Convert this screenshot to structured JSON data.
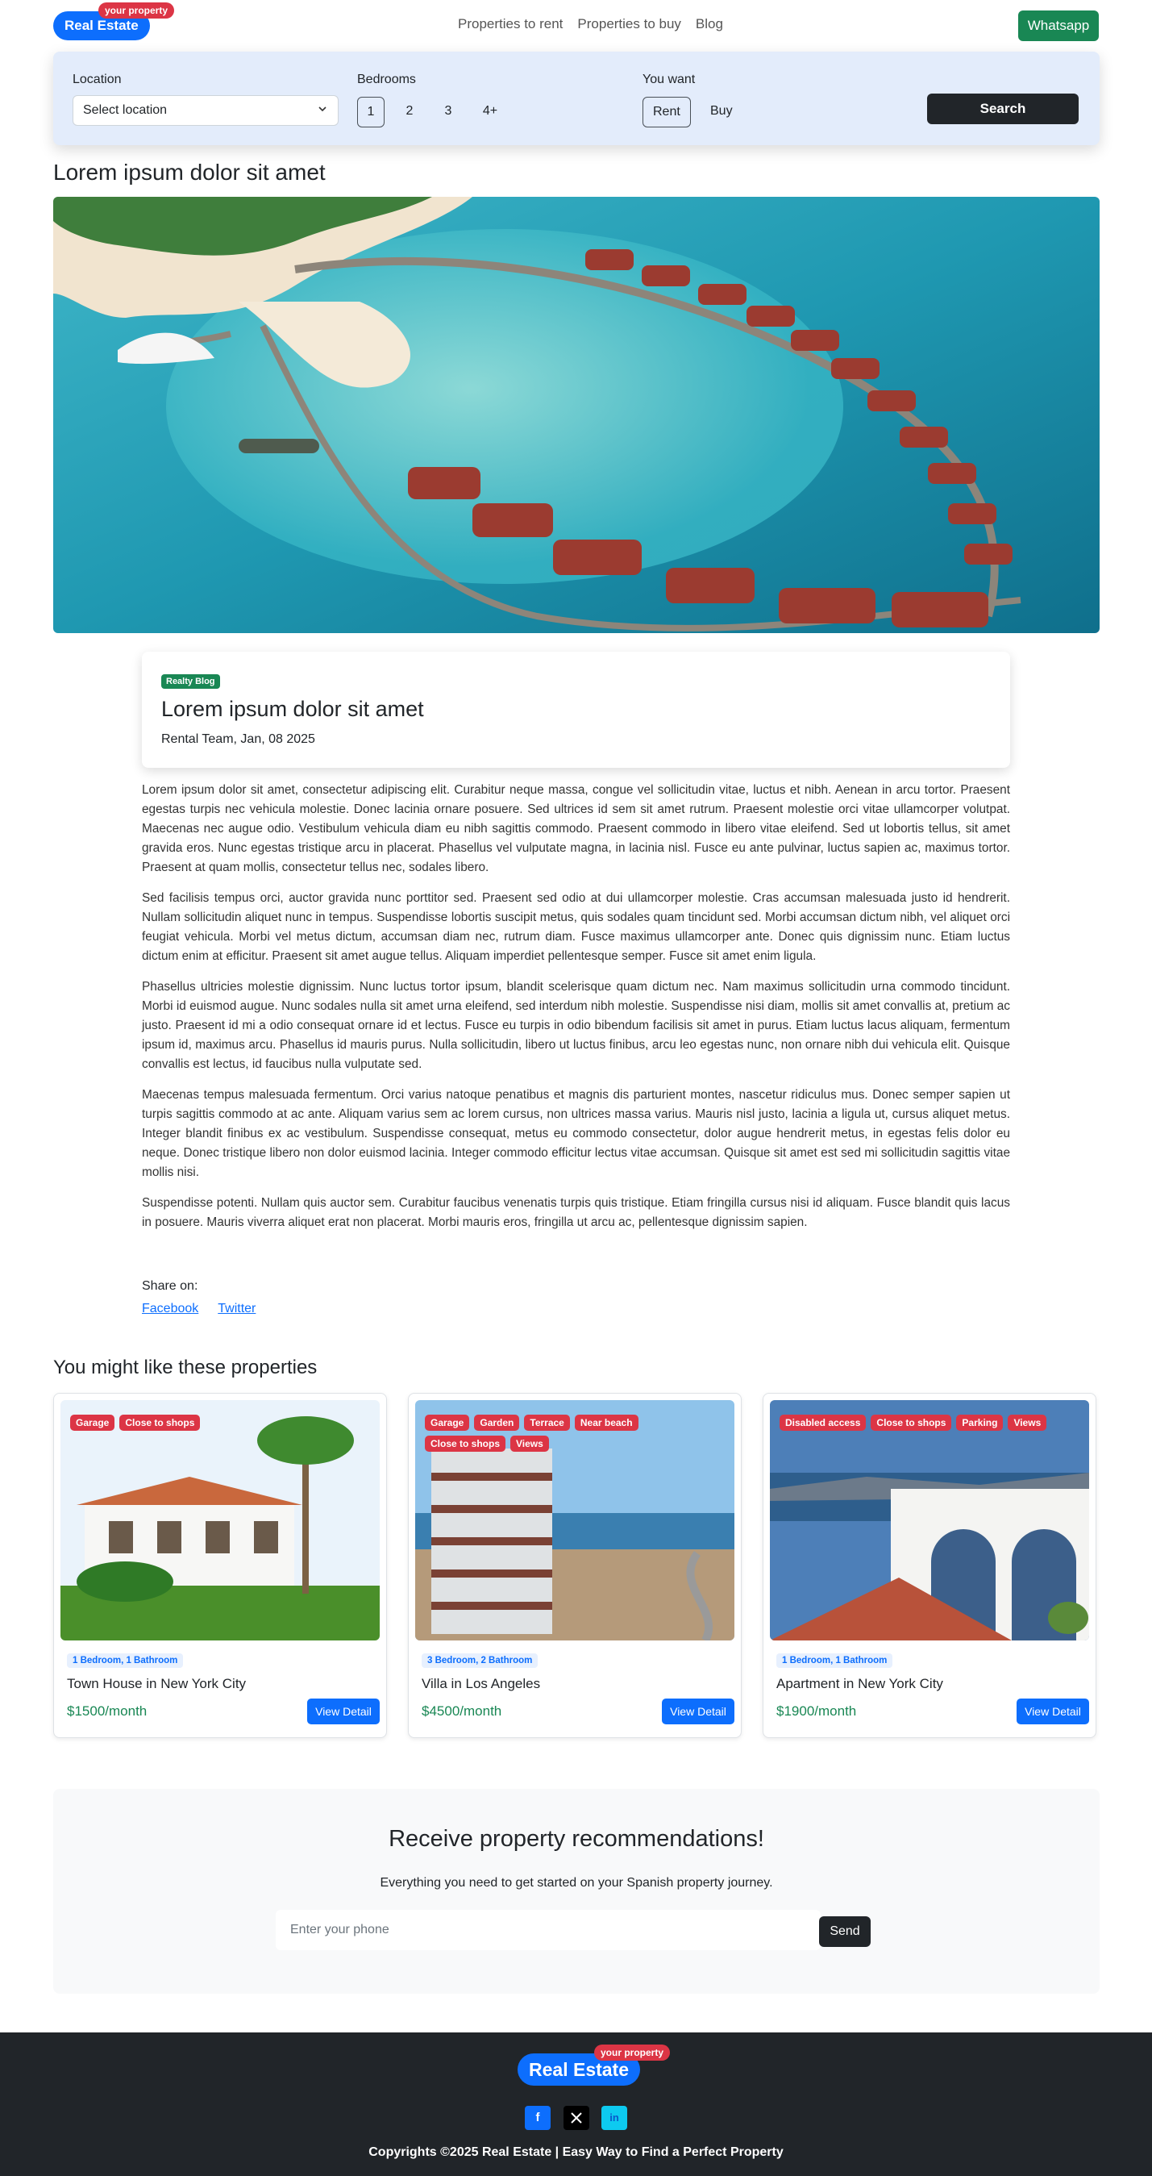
{
  "nav": {
    "logo": "Real Estate",
    "logo_badge": "your property",
    "links": [
      "Properties to rent",
      "Properties to buy",
      "Blog"
    ],
    "whatsapp": "Whatsapp"
  },
  "search": {
    "location_label": "Location",
    "location_value": "Select location",
    "bedrooms_label": "Bedrooms",
    "bedrooms": [
      "1",
      "2",
      "3",
      "4+"
    ],
    "bedrooms_selected": "1",
    "want_label": "You want",
    "want_options": [
      "Rent",
      "Buy"
    ],
    "want_selected": "Rent",
    "button": "Search"
  },
  "page_title": "Lorem ipsum dolor sit amet",
  "card": {
    "badge": "Realty Blog",
    "title": "Lorem ipsum dolor sit amet",
    "meta": "Rental Team,  Jan, 08 2025"
  },
  "article": [
    "Lorem ipsum dolor sit amet, consectetur adipiscing elit. Curabitur neque massa, congue vel sollicitudin vitae, luctus et nibh. Aenean in arcu tortor. Praesent egestas turpis nec vehicula molestie. Donec lacinia ornare posuere. Sed ultrices id sem sit amet rutrum. Praesent molestie orci vitae ullamcorper volutpat. Maecenas nec augue odio. Vestibulum vehicula diam eu nibh sagittis commodo. Praesent commodo in libero vitae eleifend. Sed ut lobortis tellus, sit amet gravida eros. Nunc egestas tristique arcu in placerat. Phasellus vel vulputate magna, in lacinia nisl. Fusce eu ante pulvinar, luctus sapien ac, maximus tortor. Praesent at quam mollis, consectetur tellus nec, sodales libero.",
    "Sed facilisis tempus orci, auctor gravida nunc porttitor sed. Praesent sed odio at dui ullamcorper molestie. Cras accumsan malesuada justo id hendrerit. Nullam sollicitudin aliquet nunc in tempus. Suspendisse lobortis suscipit metus, quis sodales quam tincidunt sed. Morbi accumsan dictum nibh, vel aliquet orci feugiat vehicula. Morbi vel metus dictum, accumsan diam nec, rutrum diam. Fusce maximus ullamcorper ante. Donec quis dignissim nunc. Etiam luctus dictum enim at efficitur. Praesent sit amet augue tellus. Aliquam imperdiet pellentesque semper. Fusce sit amet enim ligula.",
    "Phasellus ultricies molestie dignissim. Nunc luctus tortor ipsum, blandit scelerisque quam dictum nec. Nam maximus sollicitudin urna commodo tincidunt. Morbi id euismod augue. Nunc sodales nulla sit amet urna eleifend, sed interdum nibh molestie. Suspendisse nisi diam, mollis sit amet convallis at, pretium ac justo. Praesent id mi a odio consequat ornare id et lectus. Fusce eu turpis in odio bibendum facilisis sit amet in purus. Etiam luctus lacus aliquam, fermentum ipsum id, maximus arcu. Phasellus id mauris purus. Nulla sollicitudin, libero ut luctus finibus, arcu leo egestas nunc, non ornare nibh dui vehicula elit. Quisque convallis est lectus, id faucibus nulla vulputate sed.",
    "Maecenas tempus malesuada fermentum. Orci varius natoque penatibus et magnis dis parturient montes, nascetur ridiculus mus. Donec semper sapien ut turpis sagittis commodo at ac ante. Aliquam varius sem ac lorem cursus, non ultrices massa varius. Mauris nisl justo, lacinia a ligula ut, cursus aliquet metus. Integer blandit finibus ex ac vestibulum. Suspendisse consequat, metus eu commodo consectetur, dolor augue hendrerit metus, in egestas felis dolor eu neque. Donec tristique libero non dolor euismod lacinia. Integer commodo efficitur lectus vitae accumsan. Quisque sit amet est sed mi sollicitudin sagittis vitae mollis nisi.",
    "Suspendisse potenti. Nullam quis auctor sem. Curabitur faucibus venenatis turpis quis tristique. Etiam fringilla cursus nisi id aliquam. Fusce blandit quis lacus in posuere. Mauris viverra aliquet erat non placerat. Morbi mauris eros, fringilla ut arcu ac, pellentesque dignissim sapien."
  ],
  "share": {
    "label": "Share on:",
    "links": [
      "Facebook",
      "Twitter"
    ]
  },
  "related": {
    "title": "You might like these properties",
    "properties": [
      {
        "tags": [
          "Garage",
          "Close to shops"
        ],
        "beds": "1 Bedroom, 1 Bathroom",
        "name": "Town House in New York City",
        "price": "$1500",
        "unit": "/month",
        "button": "View Detail"
      },
      {
        "tags": [
          "Garage",
          "Garden",
          "Terrace",
          "Near beach",
          "Close to shops",
          "Views"
        ],
        "beds": "3 Bedroom, 2 Bathroom",
        "name": "Villa in Los Angeles",
        "price": "$4500",
        "unit": "/month",
        "button": "View Detail"
      },
      {
        "tags": [
          "Disabled access",
          "Close to shops",
          "Parking",
          "Views"
        ],
        "beds": "1 Bedroom, 1 Bathroom",
        "name": "Apartment in New York City",
        "price": "$1900",
        "unit": "/month",
        "button": "View Detail"
      }
    ]
  },
  "reco": {
    "title": "Receive property recommendations!",
    "subtitle": "Everything you need to get started on your Spanish property journey.",
    "placeholder": "Enter your phone",
    "button": "Send"
  },
  "footer": {
    "logo": "Real Estate",
    "logo_badge": "your property",
    "copyright": "Copyrights ©2025 Real Estate | Easy Way to Find a Perfect Property",
    "social_icons": [
      "facebook-icon",
      "x-icon",
      "linkedin-icon"
    ]
  },
  "colors": {
    "primary": "#0d6efd",
    "success": "#198754",
    "danger": "#dc3545",
    "dark": "#212529"
  }
}
